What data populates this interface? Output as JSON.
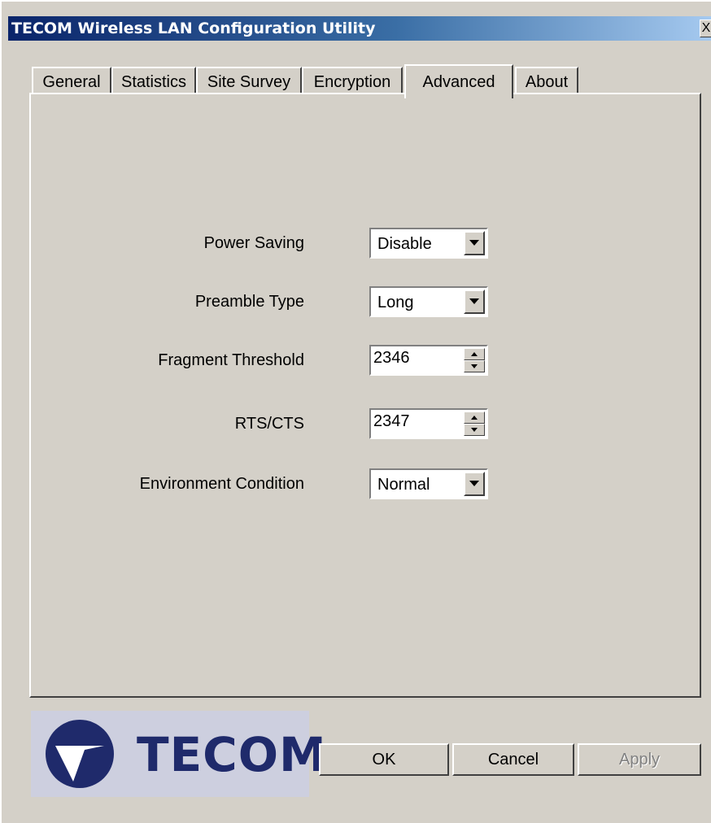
{
  "window": {
    "title": "TECOM Wireless LAN Configuration Utility",
    "close_glyph": "X"
  },
  "tabs": [
    {
      "label": "General",
      "active": false
    },
    {
      "label": "Statistics",
      "active": false
    },
    {
      "label": "Site Survey",
      "active": false
    },
    {
      "label": "Encryption",
      "active": false
    },
    {
      "label": "Advanced",
      "active": true
    },
    {
      "label": "About",
      "active": false
    }
  ],
  "advanced": {
    "power_saving": {
      "label": "Power Saving",
      "value": "Disable"
    },
    "preamble_type": {
      "label": "Preamble Type",
      "value": "Long"
    },
    "fragment_threshold": {
      "label": "Fragment Threshold",
      "value": "2346"
    },
    "rts_cts": {
      "label": "RTS/CTS",
      "value": "2347"
    },
    "environment_condition": {
      "label": "Environment Condition",
      "value": "Normal"
    }
  },
  "logo": {
    "text": "TECOM",
    "icon": "tecom-logo-icon",
    "color": "#1f2a6b"
  },
  "buttons": {
    "ok": "OK",
    "cancel": "Cancel",
    "apply": "Apply"
  }
}
